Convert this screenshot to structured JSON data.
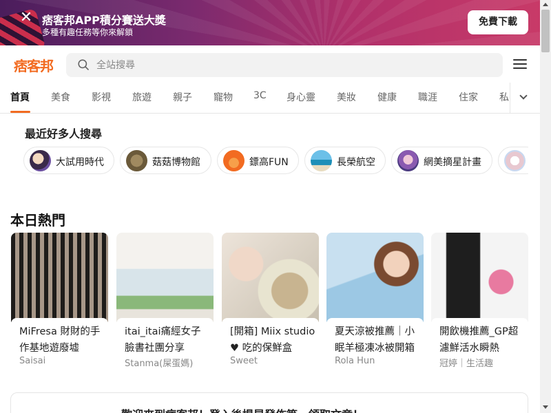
{
  "banner": {
    "title": "痞客邦APP積分賽送大獎",
    "subtitle": "多種有趣任務等你來解鎖",
    "download_label": "免費下載",
    "close_icon": "close-icon"
  },
  "header": {
    "logo_text": "痞客邦",
    "search_placeholder": "全站搜尋",
    "brand_color": "#f26b21"
  },
  "tabs": [
    {
      "label": "首頁",
      "active": true
    },
    {
      "label": "美食"
    },
    {
      "label": "影視"
    },
    {
      "label": "旅遊"
    },
    {
      "label": "親子"
    },
    {
      "label": "寵物"
    },
    {
      "label": "3C"
    },
    {
      "label": "身心靈"
    },
    {
      "label": "美妝"
    },
    {
      "label": "健康"
    },
    {
      "label": "職涯"
    },
    {
      "label": "住家"
    },
    {
      "label": "私"
    }
  ],
  "recent": {
    "title": "最近好多人搜尋",
    "chips": [
      {
        "label": "大試用時代"
      },
      {
        "label": "菇菇博物館"
      },
      {
        "label": "鏢高FUN"
      },
      {
        "label": "長榮航空"
      },
      {
        "label": "網美摘星計畫"
      },
      {
        "label": ""
      }
    ]
  },
  "hot": {
    "title": "本日熱門",
    "cards": [
      {
        "title": "MiFresa 財財的手作基地遊廢墟",
        "author": "Saisai"
      },
      {
        "title": "itai_itai痛經女子 臉書社團分享",
        "author": "Stanma(屎蛋媽)"
      },
      {
        "title": "[開箱] Miix studio ♥ 吃的保鮮盒",
        "author": "Sweet"
      },
      {
        "title": "夏天涼被推薦｜小眠羊極凍冰被開箱",
        "author": "Rola Hun"
      },
      {
        "title": "開飲機推薦_GP超濾鮮活水瞬熱",
        "author": "冠婷｜生活趣"
      }
    ]
  },
  "welcome": {
    "text": "歡迎來到痞客邦！登入後提昇發佈等，領取文章！"
  }
}
